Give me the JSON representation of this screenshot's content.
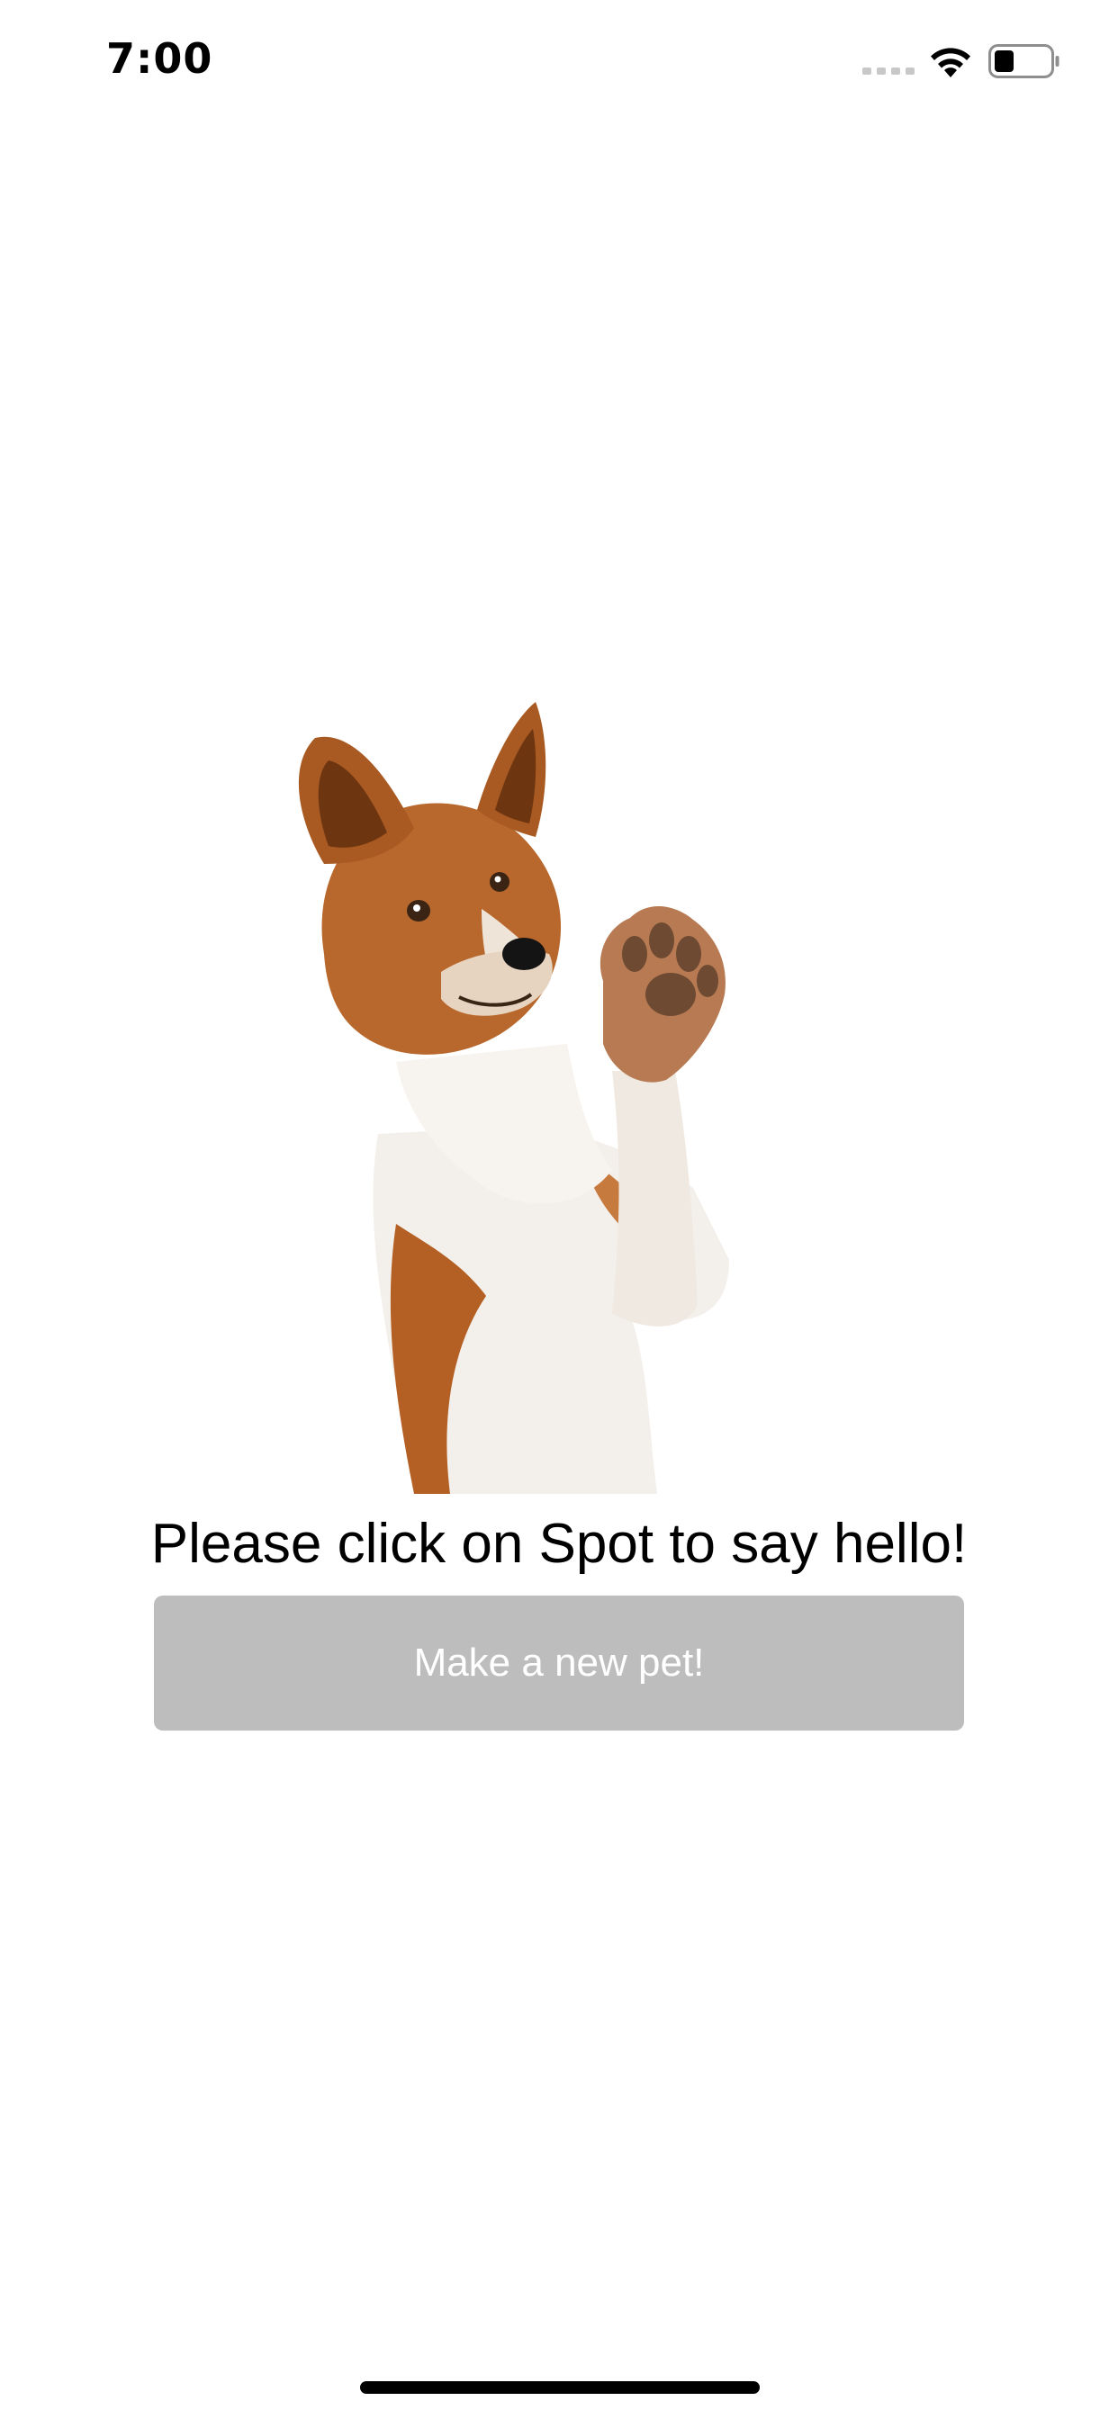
{
  "status_bar": {
    "time": "7:00",
    "icons": [
      "signal-icon",
      "wifi-icon",
      "battery-icon"
    ],
    "battery_level": 0.35
  },
  "main": {
    "image": {
      "subject": "dog-waving-paw-image"
    },
    "prompt": "Please click on Spot to say hello!",
    "button_label": "Make a new pet!"
  },
  "colors": {
    "background": "#ffffff",
    "button_background": "#bdbdbd",
    "button_text": "#ffffff",
    "text": "#000000"
  }
}
